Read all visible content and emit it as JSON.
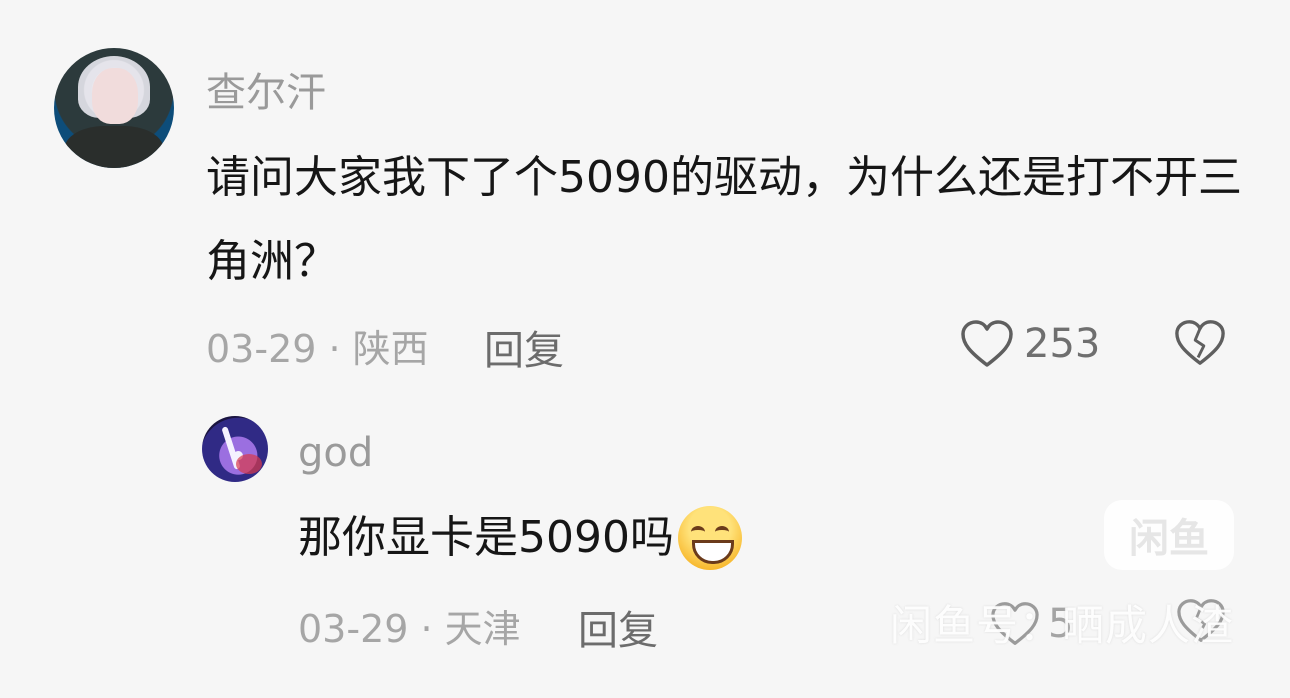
{
  "main_comment": {
    "username": "查尔汗",
    "content": "请问大家我下了个5090的驱动，为什么还是打不开三角洲？",
    "meta": "03-29 · 陕西",
    "reply_label": "回复",
    "like_count": "253",
    "like_icon": "heart-outline-icon",
    "dislike_icon": "broken-heart-icon"
  },
  "reply_comment": {
    "username": "god",
    "content": "那你显卡是5090吗",
    "emoji": "grinning-face-emoji",
    "meta": "03-29 · 天津",
    "reply_label": "回复",
    "like_count": "5",
    "like_icon": "heart-outline-icon",
    "dislike_icon": "broken-heart-icon"
  },
  "watermark": {
    "badge": "闲鱼",
    "text": "闲鱼号：晒成人渣"
  }
}
